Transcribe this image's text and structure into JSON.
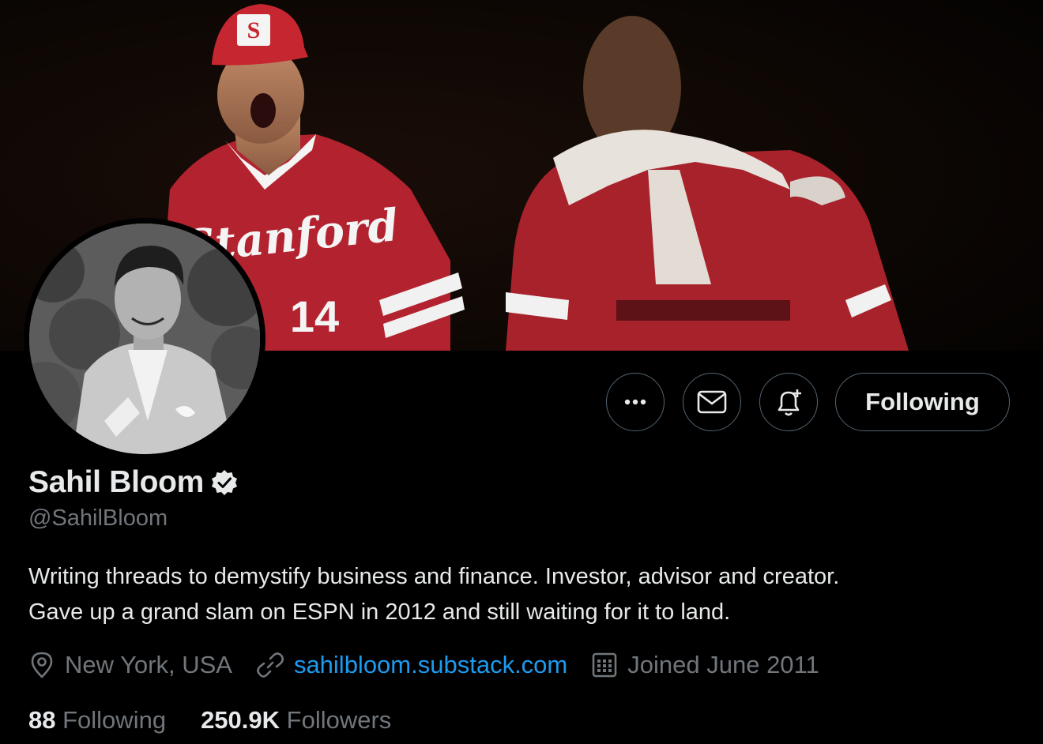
{
  "profile": {
    "name": "Sahil Bloom",
    "handle": "@SahilBloom",
    "bio_lines": [
      "Writing threads to demystify business and finance. Investor, advisor and creator.",
      "Gave up a grand slam on ESPN in 2012 and still waiting for it to land."
    ],
    "location": "New York, USA",
    "website": "sahilbloom.substack.com",
    "joined": "Joined June 2011",
    "following_count": "88",
    "following_label": "Following",
    "followers_count": "250.9K",
    "followers_label": "Followers"
  },
  "banner": {
    "cap_letter": "S",
    "jersey_script": "Stanford",
    "jersey_number": "14"
  },
  "actions": {
    "following_button": "Following"
  },
  "icons": {
    "more": "more-icon",
    "message": "mail-icon",
    "notify": "bell-plus-icon",
    "verified": "verified-badge-icon",
    "location": "location-pin-icon",
    "link": "link-icon",
    "calendar": "calendar-icon"
  },
  "colors": {
    "background": "#000000",
    "text_primary": "#e7e9ea",
    "text_secondary": "#71767b",
    "link": "#1d9bf0",
    "border": "#536471",
    "jersey_red": "#b3232f"
  }
}
